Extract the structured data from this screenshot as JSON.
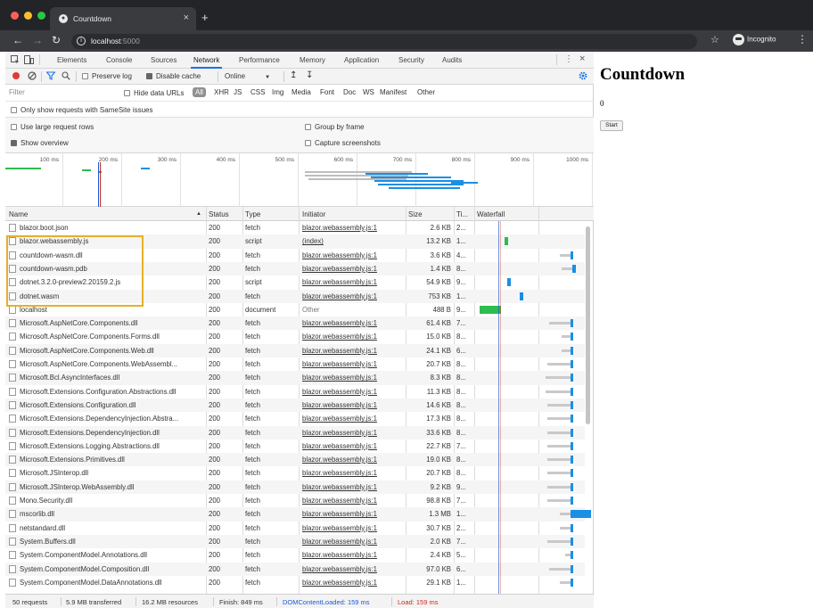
{
  "browser": {
    "tab_title": "Countdown",
    "url_host": "localhost",
    "url_port": ":5000",
    "incognito_label": "Incognito"
  },
  "devtools": {
    "tabs": [
      "Elements",
      "Console",
      "Sources",
      "Network",
      "Performance",
      "Memory",
      "Application",
      "Security",
      "Audits"
    ],
    "active_tab": "Network",
    "toolbar": {
      "preserve_log": "Preserve log",
      "preserve_log_checked": false,
      "disable_cache": "Disable cache",
      "disable_cache_checked": true,
      "throttling": "Online"
    },
    "filter": {
      "placeholder": "Filter",
      "hide_data_urls": "Hide data URLs",
      "types": [
        "All",
        "XHR",
        "JS",
        "CSS",
        "Img",
        "Media",
        "Font",
        "Doc",
        "WS",
        "Manifest",
        "Other"
      ],
      "active_type": "All",
      "samesite_only": "Only show requests with SameSite issues"
    },
    "options": {
      "large_rows": "Use large request rows",
      "show_overview": "Show overview",
      "show_overview_checked": true,
      "group_by_frame": "Group by frame",
      "capture_screenshots": "Capture screenshots"
    },
    "overview_ticks": [
      "100 ms",
      "200 ms",
      "300 ms",
      "400 ms",
      "500 ms",
      "600 ms",
      "700 ms",
      "800 ms",
      "900 ms",
      "1000 ms"
    ],
    "columns": {
      "name": "Name",
      "status": "Status",
      "type": "Type",
      "initiator": "Initiator",
      "size": "Size",
      "time": "Ti...",
      "waterfall": "Waterfall"
    },
    "requests": [
      {
        "name": "blazor.boot.json",
        "status": "200",
        "type": "fetch",
        "initiator": "blazor.webassembly.js:1",
        "size": "2.6 KB",
        "time": "2...",
        "wf": {
          "kind": "none"
        }
      },
      {
        "name": "blazor.webassembly.js",
        "status": "200",
        "type": "script",
        "initiator": "(index)",
        "size": "13.2 KB",
        "time": "1...",
        "wf": {
          "kind": "green",
          "start": 0.25,
          "gray": 0,
          "bar": 0.04
        }
      },
      {
        "name": "countdown-wasm.dll",
        "status": "200",
        "type": "fetch",
        "initiator": "blazor.webassembly.js:1",
        "size": "3.6 KB",
        "time": "4...",
        "wf": {
          "kind": "blue",
          "start": 0.88,
          "gray": 0.1,
          "bar": 0.03
        }
      },
      {
        "name": "countdown-wasm.pdb",
        "status": "200",
        "type": "fetch",
        "initiator": "blazor.webassembly.js:1",
        "size": "1.4 KB",
        "time": "8...",
        "wf": {
          "kind": "blue",
          "start": 0.9,
          "gray": 0.1,
          "bar": 0.03
        }
      },
      {
        "name": "dotnet.3.2.0-preview2.20159.2.js",
        "status": "200",
        "type": "script",
        "initiator": "blazor.webassembly.js:1",
        "size": "54.9 KB",
        "time": "9...",
        "wf": {
          "kind": "blue",
          "start": 0.28,
          "gray": 0,
          "bar": 0.03
        }
      },
      {
        "name": "dotnet.wasm",
        "status": "200",
        "type": "fetch",
        "initiator": "blazor.webassembly.js:1",
        "size": "753 KB",
        "time": "1...",
        "wf": {
          "kind": "blue",
          "start": 0.4,
          "gray": 0,
          "bar": 0.03
        }
      },
      {
        "name": "localhost",
        "status": "200",
        "type": "document",
        "initiator": "Other",
        "size": "488 B",
        "time": "9...",
        "wf": {
          "kind": "green",
          "start": 0.02,
          "gray": 0,
          "bar": 0.2
        }
      },
      {
        "name": "Microsoft.AspNetCore.Components.dll",
        "status": "200",
        "type": "fetch",
        "initiator": "blazor.webassembly.js:1",
        "size": "61.4 KB",
        "time": "7...",
        "wf": {
          "kind": "blue",
          "start": 0.88,
          "gray": 0.2,
          "bar": 0.03
        }
      },
      {
        "name": "Microsoft.AspNetCore.Components.Forms.dll",
        "status": "200",
        "type": "fetch",
        "initiator": "blazor.webassembly.js:1",
        "size": "15.0 KB",
        "time": "8...",
        "wf": {
          "kind": "blue",
          "start": 0.88,
          "gray": 0.08,
          "bar": 0.03
        }
      },
      {
        "name": "Microsoft.AspNetCore.Components.Web.dll",
        "status": "200",
        "type": "fetch",
        "initiator": "blazor.webassembly.js:1",
        "size": "24.1 KB",
        "time": "6...",
        "wf": {
          "kind": "blue",
          "start": 0.88,
          "gray": 0.08,
          "bar": 0.03
        }
      },
      {
        "name": "Microsoft.AspNetCore.Components.WebAssembl...",
        "status": "200",
        "type": "fetch",
        "initiator": "blazor.webassembly.js:1",
        "size": "20.7 KB",
        "time": "8...",
        "wf": {
          "kind": "blue",
          "start": 0.88,
          "gray": 0.22,
          "bar": 0.03
        }
      },
      {
        "name": "Microsoft.Bcl.AsyncInterfaces.dll",
        "status": "200",
        "type": "fetch",
        "initiator": "blazor.webassembly.js:1",
        "size": "8.3 KB",
        "time": "8...",
        "wf": {
          "kind": "blue",
          "start": 0.88,
          "gray": 0.24,
          "bar": 0.03
        }
      },
      {
        "name": "Microsoft.Extensions.Configuration.Abstractions.dll",
        "status": "200",
        "type": "fetch",
        "initiator": "blazor.webassembly.js:1",
        "size": "11.3 KB",
        "time": "8...",
        "wf": {
          "kind": "blue",
          "start": 0.88,
          "gray": 0.24,
          "bar": 0.03
        }
      },
      {
        "name": "Microsoft.Extensions.Configuration.dll",
        "status": "200",
        "type": "fetch",
        "initiator": "blazor.webassembly.js:1",
        "size": "14.6 KB",
        "time": "8...",
        "wf": {
          "kind": "blue",
          "start": 0.88,
          "gray": 0.22,
          "bar": 0.03
        }
      },
      {
        "name": "Microsoft.Extensions.DependencyInjection.Abstra...",
        "status": "200",
        "type": "fetch",
        "initiator": "blazor.webassembly.js:1",
        "size": "17.3 KB",
        "time": "8...",
        "wf": {
          "kind": "blue",
          "start": 0.88,
          "gray": 0.22,
          "bar": 0.03
        }
      },
      {
        "name": "Microsoft.Extensions.DependencyInjection.dll",
        "status": "200",
        "type": "fetch",
        "initiator": "blazor.webassembly.js:1",
        "size": "33.6 KB",
        "time": "8...",
        "wf": {
          "kind": "blue",
          "start": 0.88,
          "gray": 0.22,
          "bar": 0.03
        }
      },
      {
        "name": "Microsoft.Extensions.Logging.Abstractions.dll",
        "status": "200",
        "type": "fetch",
        "initiator": "blazor.webassembly.js:1",
        "size": "22.7 KB",
        "time": "7...",
        "wf": {
          "kind": "blue",
          "start": 0.88,
          "gray": 0.22,
          "bar": 0.03
        }
      },
      {
        "name": "Microsoft.Extensions.Primitives.dll",
        "status": "200",
        "type": "fetch",
        "initiator": "blazor.webassembly.js:1",
        "size": "19.0 KB",
        "time": "8...",
        "wf": {
          "kind": "blue",
          "start": 0.88,
          "gray": 0.22,
          "bar": 0.03
        }
      },
      {
        "name": "Microsoft.JSInterop.dll",
        "status": "200",
        "type": "fetch",
        "initiator": "blazor.webassembly.js:1",
        "size": "20.7 KB",
        "time": "8...",
        "wf": {
          "kind": "blue",
          "start": 0.88,
          "gray": 0.22,
          "bar": 0.03
        }
      },
      {
        "name": "Microsoft.JSInterop.WebAssembly.dll",
        "status": "200",
        "type": "fetch",
        "initiator": "blazor.webassembly.js:1",
        "size": "9.2 KB",
        "time": "9...",
        "wf": {
          "kind": "blue",
          "start": 0.88,
          "gray": 0.22,
          "bar": 0.03
        }
      },
      {
        "name": "Mono.Security.dll",
        "status": "200",
        "type": "fetch",
        "initiator": "blazor.webassembly.js:1",
        "size": "98.8 KB",
        "time": "7...",
        "wf": {
          "kind": "blue",
          "start": 0.88,
          "gray": 0.22,
          "bar": 0.03
        }
      },
      {
        "name": "mscorlib.dll",
        "status": "200",
        "type": "fetch",
        "initiator": "blazor.webassembly.js:1",
        "size": "1.3 MB",
        "time": "1...",
        "wf": {
          "kind": "blue",
          "start": 0.88,
          "gray": 0.1,
          "bar": 0.2
        }
      },
      {
        "name": "netstandard.dll",
        "status": "200",
        "type": "fetch",
        "initiator": "blazor.webassembly.js:1",
        "size": "30.7 KB",
        "time": "2...",
        "wf": {
          "kind": "blue",
          "start": 0.88,
          "gray": 0.1,
          "bar": 0.03
        }
      },
      {
        "name": "System.Buffers.dll",
        "status": "200",
        "type": "fetch",
        "initiator": "blazor.webassembly.js:1",
        "size": "2.0 KB",
        "time": "7...",
        "wf": {
          "kind": "blue",
          "start": 0.88,
          "gray": 0.22,
          "bar": 0.03
        }
      },
      {
        "name": "System.ComponentModel.Annotations.dll",
        "status": "200",
        "type": "fetch",
        "initiator": "blazor.webassembly.js:1",
        "size": "2.4 KB",
        "time": "5...",
        "wf": {
          "kind": "blue",
          "start": 0.88,
          "gray": 0.05,
          "bar": 0.03
        }
      },
      {
        "name": "System.ComponentModel.Composition.dll",
        "status": "200",
        "type": "fetch",
        "initiator": "blazor.webassembly.js:1",
        "size": "97.0 KB",
        "time": "6...",
        "wf": {
          "kind": "blue",
          "start": 0.88,
          "gray": 0.2,
          "bar": 0.03
        }
      },
      {
        "name": "System.ComponentModel.DataAnnotations.dll",
        "status": "200",
        "type": "fetch",
        "initiator": "blazor.webassembly.js:1",
        "size": "29.1 KB",
        "time": "1...",
        "wf": {
          "kind": "blue",
          "start": 0.88,
          "gray": 0.1,
          "bar": 0.03
        }
      }
    ],
    "status_bar": {
      "requests": "50 requests",
      "transferred": "5.9 MB transferred",
      "resources": "16.2 MB resources",
      "finish": "Finish: 849 ms",
      "dcl": "DOMContentLoaded: 159 ms",
      "load": "Load: 159 ms"
    },
    "colors": {
      "accent": "#1a73e8",
      "waterfall_blue": "#1a8fe6",
      "waterfall_green": "#2ebc4f",
      "dcl": "#1a5bd6",
      "load": "#d0271d",
      "record": "#e53935",
      "highlight": "#e6b02a"
    }
  },
  "page": {
    "heading": "Countdown",
    "count": "0",
    "button_label": "Start"
  }
}
